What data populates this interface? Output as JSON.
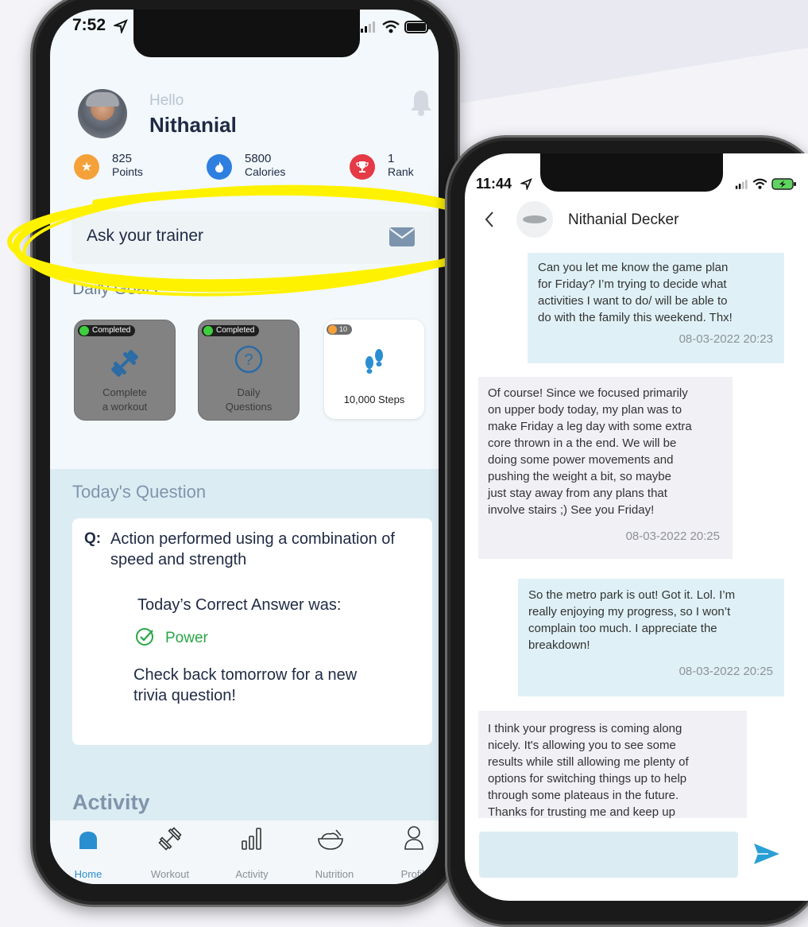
{
  "left_phone": {
    "status": {
      "time": "7:52"
    },
    "greeting": {
      "hello": "Hello",
      "name": "Nithanial"
    },
    "stats": [
      {
        "value": "825",
        "label": "Points",
        "icon": "star-icon",
        "color": "#f5a13a"
      },
      {
        "value": "5800",
        "label": "Calories",
        "icon": "flame-icon",
        "color": "#2f7fe0"
      },
      {
        "value": "1",
        "label": "Rank",
        "icon": "trophy-icon",
        "color": "#e53945"
      }
    ],
    "ask_trainer": {
      "label": "Ask your trainer",
      "icon": "mail-icon"
    },
    "daily_goals": {
      "title": "Daily Goals",
      "tiles": [
        {
          "status": "Completed",
          "label_line1": "Complete",
          "label_line2": "a workout",
          "icon": "dumbbell-icon"
        },
        {
          "status": "Completed",
          "label_line1": "Daily",
          "label_line2": "Questions",
          "icon": "question-icon"
        },
        {
          "points": "10",
          "label": "10,000 Steps",
          "icon": "footsteps-icon"
        }
      ]
    },
    "question": {
      "section_title": "Today's Question",
      "q_prefix": "Q:",
      "q_line1": "Action performed using a combination of",
      "q_line2": "speed and strength",
      "answer_heading": "Today’s Correct Answer was:",
      "answer": "Power",
      "footer_line1": "Check back tomorrow for a new",
      "footer_line2": "trivia question!"
    },
    "activity_title": "Activity",
    "nav": [
      {
        "label": "Home",
        "icon": "home-icon",
        "active": true
      },
      {
        "label": "Workout",
        "icon": "dumbbell-icon"
      },
      {
        "label": "Activity",
        "icon": "bar-chart-icon"
      },
      {
        "label": "Nutrition",
        "icon": "bowl-icon"
      },
      {
        "label": "Profile",
        "icon": "user-icon"
      }
    ],
    "colors": {
      "accent": "#2a8fd0",
      "highlight": "#fff200"
    }
  },
  "right_phone": {
    "status": {
      "time": "11:44"
    },
    "header": {
      "name": "Nithanial  Decker"
    },
    "messages": [
      {
        "side": "sent",
        "text": "Can you let me know the game plan\nfor Friday? I’m trying to decide what\nactivities I want to do/ will be able to\ndo with the family this weekend. Thx!",
        "time": "08-03-2022 20:23"
      },
      {
        "side": "received",
        "text": "Of course! Since we focused primarily\non upper body today, my plan was to\nmake Friday a leg day with some extra\ncore thrown in a the end. We will be\ndoing some power movements and\npushing the weight a bit, so maybe\njust stay away from any plans that\ninvolve stairs ;) See you Friday!",
        "time": "08-03-2022 20:25"
      },
      {
        "side": "sent",
        "text": "So the metro park is out! Got it. Lol. I’m\nreally enjoying my progress, so I won’t\ncomplain too much. I appreciate the\nbreakdown!",
        "time": "08-03-2022 20:25"
      },
      {
        "side": "received",
        "text": "I think your progress is coming along\nnicely. It's allowing you to see some\nresults while still allowing me plenty of\noptions for switching things up to help\nthrough some plateaus in the future.\nThanks for trusting me and keep up",
        "time": ""
      }
    ],
    "colors": {
      "sent_bg": "#dff1f6",
      "received_bg": "#f0f0f5",
      "send": "#2a9fd6"
    }
  }
}
